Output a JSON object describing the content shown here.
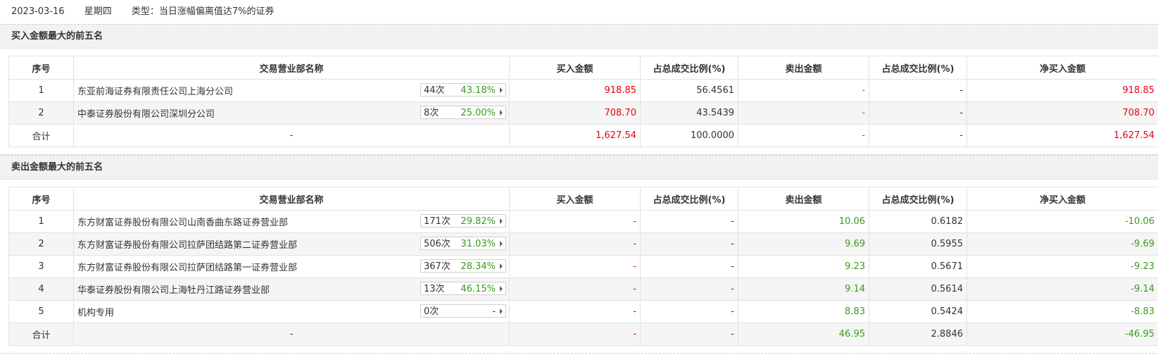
{
  "header": {
    "date": "2023-03-16",
    "weekday": "星期四",
    "type": "类型：当日涨幅偏离值达7%的证券"
  },
  "columns": {
    "seq": "序号",
    "name": "交易营业部名称",
    "buy": "买入金额",
    "buy_ratio": "占总成交比例(%)",
    "sell": "卖出金额",
    "sell_ratio": "占总成交比例(%)",
    "net": "净买入金额"
  },
  "colors": {
    "up": "#e60012",
    "down": "#3b9b1b"
  },
  "buy_section": {
    "title": "买入金额最大的前五名",
    "rows": [
      {
        "seq": "1",
        "name": "东亚前海证券有限责任公司上海分公司",
        "count": "44次",
        "pct": "43.18%",
        "buy": "918.85",
        "buy_ratio": "56.4561",
        "sell": "-",
        "sell_ratio": "-",
        "net": "918.85"
      },
      {
        "seq": "2",
        "name": "中泰证券股份有限公司深圳分公司",
        "count": "8次",
        "pct": "25.00%",
        "buy": "708.70",
        "buy_ratio": "43.5439",
        "sell": "-",
        "sell_ratio": "-",
        "net": "708.70"
      }
    ],
    "total": {
      "seq": "合计",
      "name": "-",
      "buy": "1,627.54",
      "buy_ratio": "100.0000",
      "sell": "-",
      "sell_ratio": "-",
      "net": "1,627.54"
    }
  },
  "sell_section": {
    "title": "卖出金额最大的前五名",
    "rows": [
      {
        "seq": "1",
        "name": "东方财富证券股份有限公司山南香曲东路证券营业部",
        "count": "171次",
        "pct": "29.82%",
        "buy": "-",
        "buy_ratio": "-",
        "sell": "10.06",
        "sell_ratio": "0.6182",
        "net": "-10.06"
      },
      {
        "seq": "2",
        "name": "东方财富证券股份有限公司拉萨团结路第二证券营业部",
        "count": "506次",
        "pct": "31.03%",
        "buy": "-",
        "buy_ratio": "-",
        "sell": "9.69",
        "sell_ratio": "0.5955",
        "net": "-9.69"
      },
      {
        "seq": "3",
        "name": "东方财富证券股份有限公司拉萨团结路第一证券营业部",
        "count": "367次",
        "pct": "28.34%",
        "buy": "-",
        "buy_ratio": "-",
        "sell": "9.23",
        "sell_ratio": "0.5671",
        "net": "-9.23"
      },
      {
        "seq": "4",
        "name": "华泰证券股份有限公司上海牡丹江路证券营业部",
        "count": "13次",
        "pct": "46.15%",
        "buy": "-",
        "buy_ratio": "-",
        "sell": "9.14",
        "sell_ratio": "0.5614",
        "net": "-9.14"
      },
      {
        "seq": "5",
        "name": "机构专用",
        "count": "0次",
        "pct": "-",
        "buy": "-",
        "buy_ratio": "-",
        "sell": "8.83",
        "sell_ratio": "0.5424",
        "net": "-8.83"
      }
    ],
    "total": {
      "seq": "合计",
      "name": "-",
      "buy": "-",
      "buy_ratio": "-",
      "sell": "46.95",
      "sell_ratio": "2.8846",
      "net": "-46.95"
    }
  }
}
